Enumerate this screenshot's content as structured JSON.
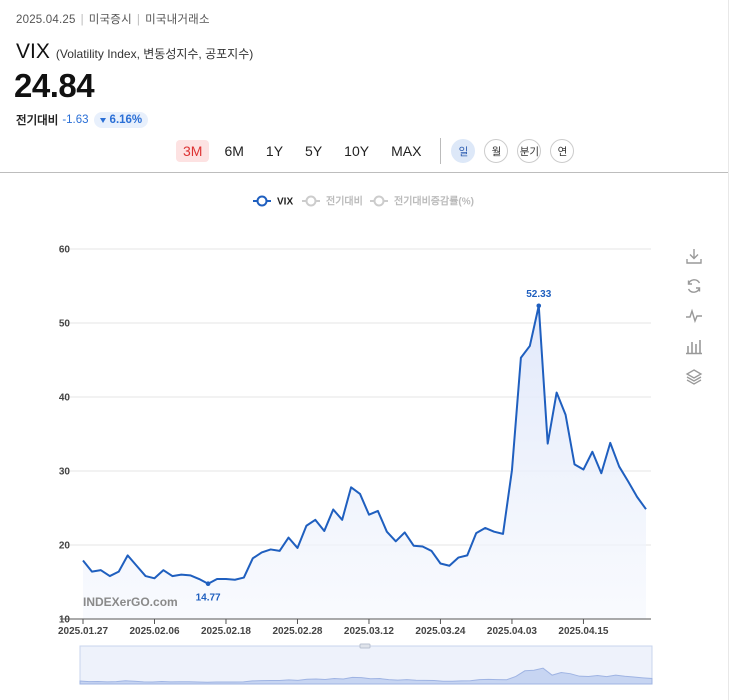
{
  "header": {
    "date": "2025.04.25",
    "market": "미국증시",
    "exchange": "미국내거래소",
    "title": "VIX",
    "subtitle": "(Volatility Index, 변동성지수, 공포지수)",
    "price": "24.84",
    "change_label": "전기대비",
    "change_value": "-1.63",
    "change_pct": "6.16%"
  },
  "range_tabs": [
    {
      "label": "3M",
      "active": true
    },
    {
      "label": "6M",
      "active": false
    },
    {
      "label": "1Y",
      "active": false
    },
    {
      "label": "5Y",
      "active": false
    },
    {
      "label": "10Y",
      "active": false
    },
    {
      "label": "MAX",
      "active": false
    }
  ],
  "period_tabs": [
    {
      "label": "일",
      "active": true
    },
    {
      "label": "월",
      "active": false
    },
    {
      "label": "분기",
      "active": false
    },
    {
      "label": "연",
      "active": false
    }
  ],
  "colors": {
    "line": "#1f5fbf",
    "area": "#e9eefb",
    "accent_red": "#d33",
    "accent_blue": "#2a6fd6"
  },
  "chart_data": {
    "type": "area",
    "legend": [
      "VIX",
      "전기대비",
      "전기대비증감률(%)"
    ],
    "legend_active": [
      true,
      false,
      false
    ],
    "ylim": [
      10,
      60
    ],
    "yticks": [
      10,
      20,
      30,
      40,
      50,
      60
    ],
    "xtick_labels": [
      "2025.01.27",
      "2025.02.06",
      "2025.02.18",
      "2025.02.28",
      "2025.03.12",
      "2025.03.24",
      "2025.04.03",
      "2025.04.15"
    ],
    "xtick_index": [
      0,
      8,
      16,
      24,
      32,
      40,
      48,
      56
    ],
    "watermark": "INDEXerGO.com",
    "series": [
      {
        "values": [
          17.9,
          16.4,
          16.6,
          15.8,
          16.4,
          18.6,
          17.2,
          15.8,
          15.5,
          16.6,
          15.8,
          16.0,
          15.9,
          15.4,
          14.77,
          15.4,
          15.4,
          15.3,
          15.6,
          18.2,
          19.0,
          19.4,
          19.2,
          21.0,
          19.6,
          22.6,
          23.4,
          21.9,
          24.8,
          23.4,
          27.8,
          26.9,
          24.1,
          24.6,
          21.8,
          20.5,
          21.7,
          19.9,
          19.8,
          19.2,
          17.5,
          17.2,
          18.3,
          18.6,
          21.6,
          22.3,
          21.8,
          21.5,
          30.1,
          45.3,
          46.9,
          52.33,
          33.7,
          40.6,
          37.6,
          30.9,
          30.2,
          32.6,
          29.7,
          33.8,
          30.6,
          28.6,
          26.5,
          24.84
        ]
      }
    ],
    "annotations": [
      {
        "label": "52.33",
        "index": 51
      },
      {
        "label": "14.77",
        "index": 14
      }
    ]
  }
}
